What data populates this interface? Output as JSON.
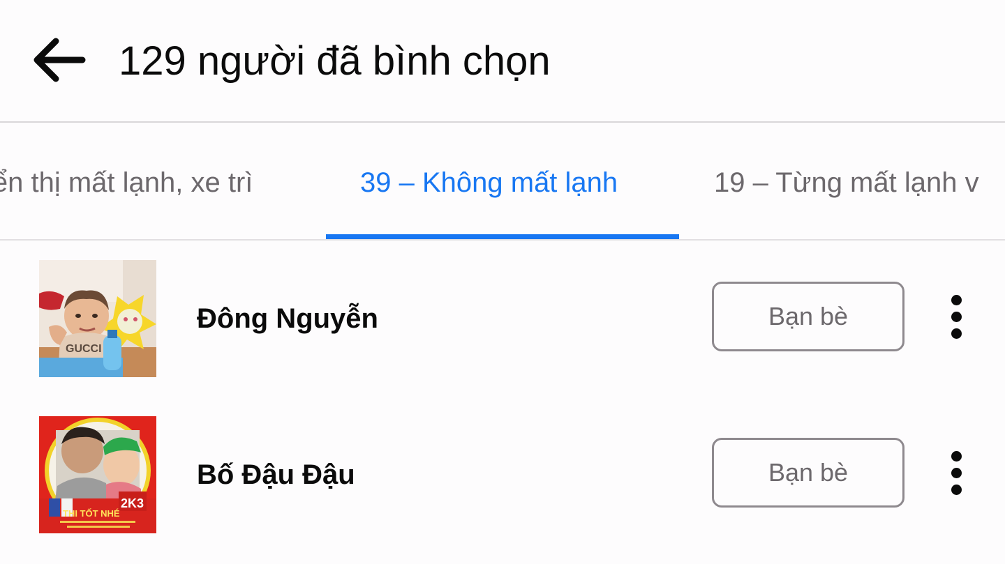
{
  "header": {
    "title": "129 người đã bình chọn",
    "back_icon": "arrow-left-icon"
  },
  "tabs": [
    {
      "label": "iển thị mất lạnh, xe trì",
      "active": false
    },
    {
      "label": "39 – Không mất lạnh",
      "active": true
    },
    {
      "label": "19 – Từng mất lạnh v",
      "active": false
    }
  ],
  "colors": {
    "accent": "#1877f2",
    "text": "#0b0b0b",
    "muted": "#6c686c"
  },
  "voters": [
    {
      "name": "Đông Nguyễn",
      "button_label": "Bạn bè",
      "more_icon": "more-vertical-icon"
    },
    {
      "name": "Bố Đậu Đậu",
      "button_label": "Bạn bè",
      "more_icon": "more-vertical-icon"
    }
  ]
}
